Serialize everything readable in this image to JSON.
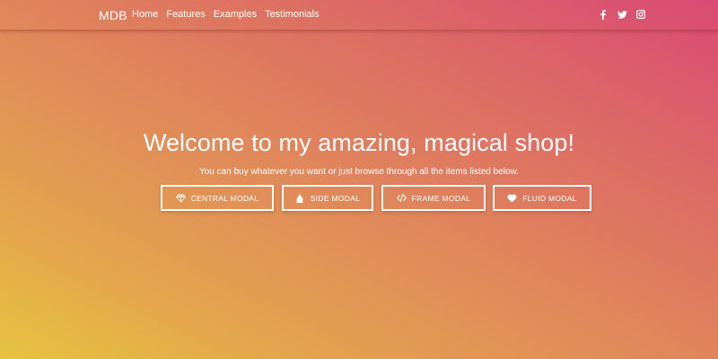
{
  "navbar": {
    "brand": "MDB",
    "links": [
      "Home",
      "Features",
      "Examples",
      "Testimonials"
    ],
    "social_icons": [
      "facebook-icon",
      "twitter-icon",
      "instagram-icon"
    ]
  },
  "hero": {
    "title": "Welcome to my amazing, magical shop!",
    "subtitle": "You can buy whatever you want or just browse through all the items listed below."
  },
  "buttons": [
    {
      "label": "CENTRAL MODAL",
      "icon": "diamond-icon"
    },
    {
      "label": "SIDE MODAL",
      "icon": "droplet-icon"
    },
    {
      "label": "FRAME MODAL",
      "icon": "code-icon"
    },
    {
      "label": "FLUID MODAL",
      "icon": "heart-icon"
    }
  ],
  "colors": {
    "gradient_start": "#e6c33f",
    "gradient_mid": "#e08a5a",
    "gradient_end": "#d94a74",
    "text": "#ffffff"
  }
}
